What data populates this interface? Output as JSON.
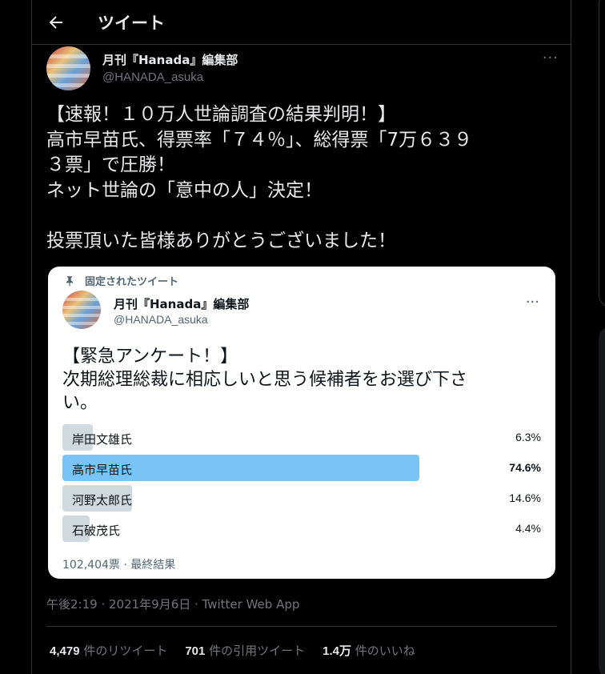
{
  "header": {
    "title": "ツイート"
  },
  "author": {
    "name": "月刊『Hanada』編集部",
    "handle": "@HANADA_asuka",
    "more": "···"
  },
  "tweet": {
    "lines": [
      "【速報！１０万人世論調査の結果判明！】",
      "高市早苗氏、得票率「７４％」、総得票「7万６３９",
      "３票」で圧勝！",
      "ネット世論の「意中の人」決定！",
      "",
      "投票頂いた皆様ありがとうございました！"
    ]
  },
  "quote": {
    "pinned_label": "固定されたツイート",
    "name": "月刊『Hanada』編集部",
    "handle": "@HANADA_asuka",
    "more": "···",
    "lines": [
      "【緊急アンケート！】",
      "次期総理総裁に相応しいと思う候補者をお選び下さ",
      "い。"
    ],
    "poll": {
      "options": [
        {
          "label": "岸田文雄氏",
          "percent": "6.3%",
          "value": 6.3,
          "winner": false
        },
        {
          "label": "高市早苗氏",
          "percent": "74.6%",
          "value": 74.6,
          "winner": true
        },
        {
          "label": "河野太郎氏",
          "percent": "14.6%",
          "value": 14.6,
          "winner": false
        },
        {
          "label": "石破茂氏",
          "percent": "4.4%",
          "value": 4.4,
          "winner": false
        }
      ],
      "footer": "102,404票 · 最終結果"
    }
  },
  "meta": "午後2:19 · 2021年9月6日 · Twitter Web App",
  "stats": {
    "retweets_count": "4,479",
    "retweets_label": " 件のリツイート",
    "quotes_count": "701",
    "quotes_label": " 件の引用ツイート",
    "likes_count": "1.4万",
    "likes_label": " 件のいいね"
  },
  "colors": {
    "poll_winner": "#78c5f5",
    "poll_other": "#cfd9de",
    "background": "#000000"
  }
}
